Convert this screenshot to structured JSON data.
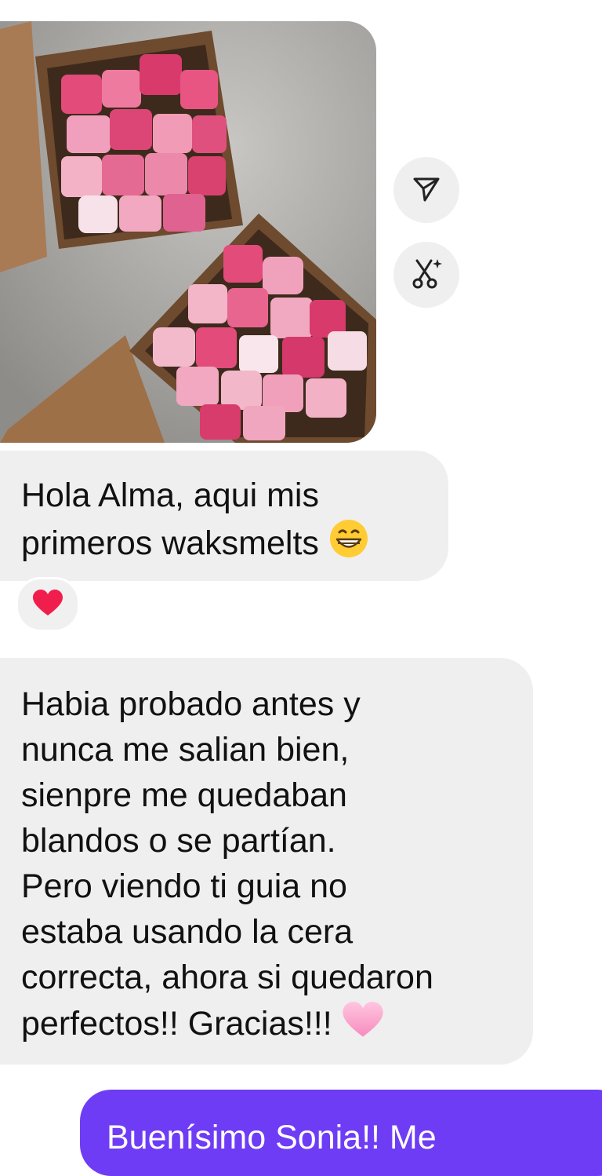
{
  "messages": {
    "m1": "Hola Alma, aqui mis\nprimeros waksmelts",
    "m2": "Habia probado antes y\nnunca me salian bien,\nsienpre me quedaban\nblandos o se partían.\nPero viendo ti guia no\nestaba usando la cera\ncorrecta, ahora si quedaron\nperfectos!! Gracias!!!",
    "m3": "Buenísimo Sonia!! Me"
  },
  "icons": {
    "share": "paper-plane-icon",
    "remix": "sparkle-scissors-icon",
    "reaction": "red-heart-emoji",
    "grin": "grinning-face-emoji",
    "pink_heart": "pink-heart-emoji"
  },
  "colors": {
    "received_bubble": "#efefef",
    "sent_bubble": "#6f3cf6",
    "text": "#111111"
  }
}
